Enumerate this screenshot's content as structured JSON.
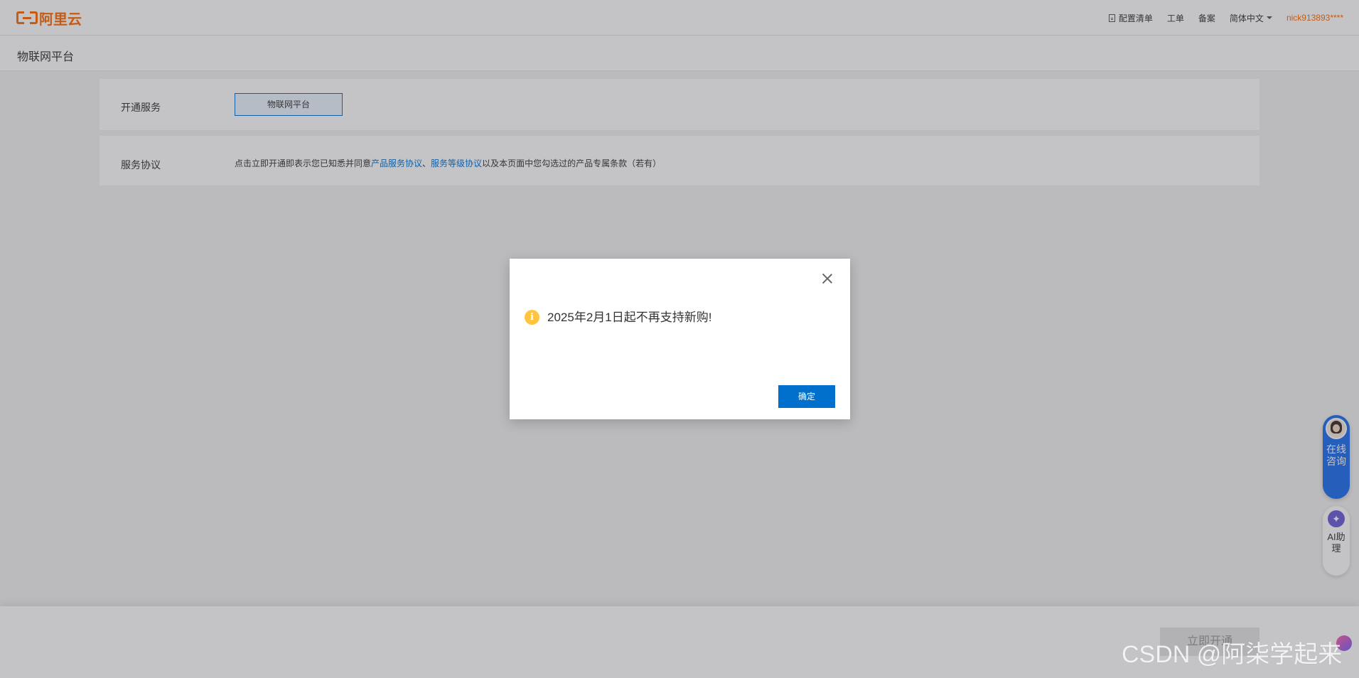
{
  "header": {
    "logo_text": "阿里云",
    "nav": {
      "config_list": "配置清单",
      "ticket": "工单",
      "filing": "备案",
      "language": "简体中文",
      "username": "nick913893****"
    }
  },
  "page": {
    "title": "物联网平台"
  },
  "form": {
    "service_label": "开通服务",
    "service_option": "物联网平台",
    "agreement_label": "服务协议",
    "agreement_prefix": "点击立即开通即表示您已知悉并同意",
    "agreement_link1": "产品服务协议",
    "agreement_sep": "、",
    "agreement_link2": "服务等级协议",
    "agreement_suffix": "以及本页面中您勾选过的产品专属条款（若有）"
  },
  "footer": {
    "open_button": "立即开通"
  },
  "float_widgets": {
    "consult_label": "在线咨询",
    "ai_label": "AI助理"
  },
  "dialog": {
    "icon": "info-icon",
    "message": "2025年2月1日起不再支持新购!",
    "confirm": "确定"
  },
  "watermark": "CSDN @阿柒学起来",
  "colors": {
    "brand_orange": "#ff6a00",
    "primary_blue": "#0070cc",
    "warning_yellow": "#ffc440",
    "consult_blue": "#1e6ef0"
  }
}
